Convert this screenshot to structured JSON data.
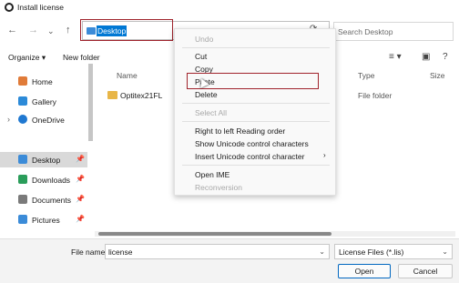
{
  "window": {
    "title": "Install license"
  },
  "address_bar": {
    "path": "Desktop",
    "search_placeholder": "Search Desktop"
  },
  "toolbar": {
    "organize": "Organize",
    "new_folder": "New folder"
  },
  "sidebar": {
    "items": [
      {
        "label": "Home",
        "icon": "home-icon",
        "color": "#e07b39"
      },
      {
        "label": "Gallery",
        "icon": "gallery-icon",
        "color": "#2c8ad8"
      },
      {
        "label": "OneDrive",
        "icon": "onedrive-icon",
        "color": "#1f78d1"
      },
      {
        "label": "Desktop",
        "icon": "desktop-icon",
        "color": "#3b8bd8",
        "selected": true
      },
      {
        "label": "Downloads",
        "icon": "downloads-icon",
        "color": "#2a9d5a"
      },
      {
        "label": "Documents",
        "icon": "documents-icon",
        "color": "#7a7a7a"
      },
      {
        "label": "Pictures",
        "icon": "pictures-icon",
        "color": "#3b8bd8"
      }
    ]
  },
  "file_list": {
    "columns": {
      "name": "Name",
      "type": "Type",
      "size": "Size"
    },
    "rows": [
      {
        "name": "Optitex21FL",
        "type": "File folder"
      }
    ]
  },
  "context_menu": {
    "items": [
      {
        "label": "Undo",
        "enabled": false
      },
      {
        "label": "Cut",
        "enabled": true
      },
      {
        "label": "Copy",
        "enabled": true
      },
      {
        "label": "Paste",
        "enabled": true,
        "highlighted": true
      },
      {
        "label": "Delete",
        "enabled": true
      },
      {
        "label": "Select All",
        "enabled": false
      },
      {
        "label": "Right to left Reading order",
        "enabled": true
      },
      {
        "label": "Show Unicode control characters",
        "enabled": true
      },
      {
        "label": "Insert Unicode control character",
        "enabled": true,
        "submenu": true
      },
      {
        "label": "Open IME",
        "enabled": true
      },
      {
        "label": "Reconversion",
        "enabled": false
      }
    ]
  },
  "footer": {
    "file_name_label": "File name:",
    "file_name_value": "license",
    "filter_value": "License Files (*.lis)",
    "open_label": "Open",
    "cancel_label": "Cancel"
  },
  "colors": {
    "accent": "#0078d4",
    "highlight_border": "#a0232c",
    "folder": "#e8b648"
  }
}
